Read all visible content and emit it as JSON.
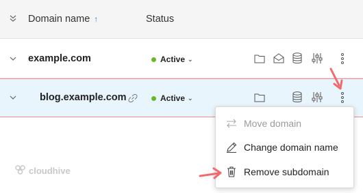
{
  "header": {
    "domain_col": "Domain name",
    "sort_icon": "sort-ascending-icon",
    "status_col": "Status"
  },
  "rows": [
    {
      "domain": "example.com",
      "status": "Active"
    },
    {
      "domain": "blog.example.com",
      "status": "Active"
    }
  ],
  "menu": {
    "items": [
      {
        "label": "Move domain",
        "icon": "move-arrows-icon",
        "disabled": true
      },
      {
        "label": "Change domain name",
        "icon": "pencil-icon",
        "disabled": false
      },
      {
        "label": "Remove subdomain",
        "icon": "trash-icon",
        "disabled": false
      }
    ]
  },
  "logo": {
    "text": "cloudhive"
  },
  "colors": {
    "accent": "#1a8fd1",
    "active_dot": "#69b72b",
    "selected_row_bg": "#e9f5fc",
    "highlight_border": "#ef8c8c",
    "annotation_arrow": "#f26b6b"
  }
}
